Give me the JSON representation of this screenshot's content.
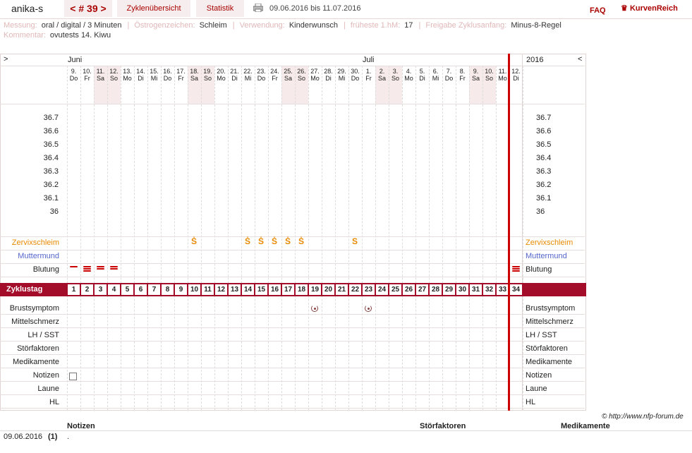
{
  "header": {
    "user": "anika-s",
    "cycle_nav": "< # 39 >",
    "tab_overview": "Zyklenübersicht",
    "tab_stats": "Statistik",
    "date_range": "09.06.2016 bis 11.07.2016",
    "faq": "FAQ",
    "logo": "KurvenReich"
  },
  "meta": {
    "messung_k": "Messung:",
    "messung_v": "oral / digital / 3 Minuten",
    "oestro_k": "Östrogenzeichen:",
    "oestro_v": "Schleim",
    "verw_k": "Verwendung:",
    "verw_v": "Kinderwunsch",
    "hm_k": "früheste 1.hM:",
    "hm_v": "17",
    "freigabe_k": "Freigabe Zyklusanfang:",
    "freigabe_v": "Minus-8-Regel",
    "komm_k": "Kommentar:",
    "komm_v": "ovutests 14. Kiwu"
  },
  "chart": {
    "nav_left": ">",
    "nav_right": "<",
    "month1": "Juni",
    "month2": "Juli",
    "year": "2016",
    "days": [
      {
        "d": "9.",
        "w": "Do"
      },
      {
        "d": "10.",
        "w": "Fr"
      },
      {
        "d": "11.",
        "w": "Sa"
      },
      {
        "d": "12.",
        "w": "So"
      },
      {
        "d": "13.",
        "w": "Mo"
      },
      {
        "d": "14.",
        "w": "Di"
      },
      {
        "d": "15.",
        "w": "Mi"
      },
      {
        "d": "16.",
        "w": "Do"
      },
      {
        "d": "17.",
        "w": "Fr"
      },
      {
        "d": "18.",
        "w": "Sa"
      },
      {
        "d": "19.",
        "w": "So"
      },
      {
        "d": "20.",
        "w": "Mo"
      },
      {
        "d": "21.",
        "w": "Di"
      },
      {
        "d": "22.",
        "w": "Mi"
      },
      {
        "d": "23.",
        "w": "Do"
      },
      {
        "d": "24.",
        "w": "Fr"
      },
      {
        "d": "25.",
        "w": "Sa"
      },
      {
        "d": "26.",
        "w": "So"
      },
      {
        "d": "27.",
        "w": "Mo"
      },
      {
        "d": "28.",
        "w": "Di"
      },
      {
        "d": "29.",
        "w": "Mi"
      },
      {
        "d": "30.",
        "w": "Do"
      },
      {
        "d": "1.",
        "w": "Fr"
      },
      {
        "d": "2.",
        "w": "Sa"
      },
      {
        "d": "3.",
        "w": "So"
      },
      {
        "d": "4.",
        "w": "Mo"
      },
      {
        "d": "5.",
        "w": "Di"
      },
      {
        "d": "6.",
        "w": "Mi"
      },
      {
        "d": "7.",
        "w": "Do"
      },
      {
        "d": "8.",
        "w": "Fr"
      },
      {
        "d": "9.",
        "w": "Sa"
      },
      {
        "d": "10.",
        "w": "So"
      },
      {
        "d": "11.",
        "w": "Mo"
      },
      {
        "d": "12.",
        "w": "Di"
      }
    ],
    "temps": [
      "36.7",
      "36.6",
      "36.5",
      "36.4",
      "36.3",
      "36.2",
      "36.1",
      "36"
    ],
    "row_zervix": "Zervixschleim",
    "row_mutter": "Muttermund",
    "row_blutung": "Blutung",
    "row_zyklustag": "Zyklustag",
    "rows_lower": [
      "Brustsymptom",
      "Mittelschmerz",
      "LH / SST",
      "Störfaktoren",
      "Medikamente",
      "Notizen",
      "Laune",
      "HL"
    ],
    "zervix_marks": [
      {
        "day": 10,
        "sym": "Ṡ"
      },
      {
        "day": 14,
        "sym": "Ṡ"
      },
      {
        "day": 15,
        "sym": "Ṡ"
      },
      {
        "day": 16,
        "sym": "Ṡ"
      },
      {
        "day": 17,
        "sym": "Ṡ"
      },
      {
        "day": 18,
        "sym": "Ṡ"
      },
      {
        "day": 22,
        "sym": "S"
      }
    ],
    "blutung": [
      {
        "day": 1,
        "lvl": 1
      },
      {
        "day": 2,
        "lvl": 3
      },
      {
        "day": 3,
        "lvl": 2
      },
      {
        "day": 4,
        "lvl": 2
      },
      {
        "day": 34,
        "lvl": 3
      }
    ],
    "brust_marks": [
      19,
      23
    ],
    "copyright": "© http://www.nfp-forum.de"
  },
  "footer": {
    "col_notizen": "Notizen",
    "col_stoer": "Störfaktoren",
    "col_medi": "Medikamente",
    "row_date": "09.06.2016",
    "row_num": "(1)",
    "row_note": "."
  },
  "colors": {
    "accent": "#a30d2a",
    "zervix": "#e88a00",
    "mutter": "#5566cc",
    "weekend": "#f6eaea"
  }
}
